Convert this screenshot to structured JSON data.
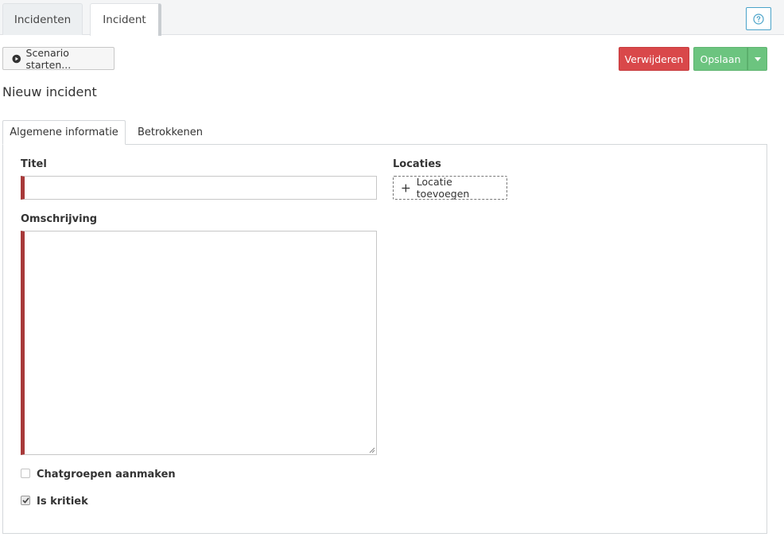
{
  "top_tabs": [
    {
      "label": "Incidenten",
      "active": false
    },
    {
      "label": "Incident",
      "active": true
    }
  ],
  "help_icon": "question-circle-icon",
  "toolbar": {
    "scenario_label": "Scenario starten...",
    "scenario_icon": "play-circle-icon",
    "delete_label": "Verwijderen",
    "save_label": "Opslaan",
    "save_menu_icon": "caret-down-icon"
  },
  "page_title": "Nieuw incident",
  "tabs": [
    {
      "label": "Algemene informatie",
      "active": true
    },
    {
      "label": "Betrokkenen",
      "active": false
    }
  ],
  "form": {
    "title_label": "Titel",
    "title_value": "",
    "description_label": "Omschrijving",
    "description_value": "",
    "locations_label": "Locaties",
    "add_location_label": "Locatie toevoegen",
    "chatgroups_label": "Chatgroepen aanmaken",
    "chatgroups_checked": false,
    "critical_label": "Is kritiek",
    "critical_checked": true
  },
  "colors": {
    "danger": "#d9484a",
    "success": "#6cc47f",
    "required_marker": "#a83a3a",
    "info": "#4aa3c9"
  }
}
